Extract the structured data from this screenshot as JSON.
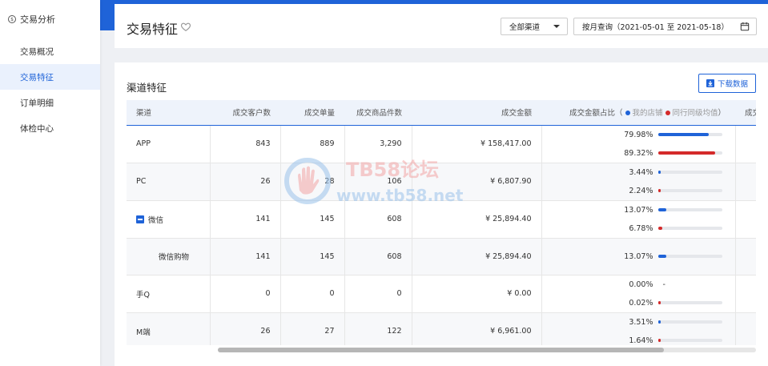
{
  "sidebar": {
    "header": "交易分析",
    "items": [
      {
        "label": "交易概况",
        "active": false
      },
      {
        "label": "交易特征",
        "active": true
      },
      {
        "label": "订单明细",
        "active": false
      },
      {
        "label": "体检中心",
        "active": false
      }
    ]
  },
  "header": {
    "title": "交易特征",
    "channel_select": "全部渠道",
    "date_range": "按月查询（2021-05-01 至 2021-05-18）"
  },
  "main": {
    "section_title": "渠道特征",
    "download_label": "下载数据",
    "columns": [
      "渠道",
      "成交客户数",
      "成交单量",
      "成交商品件数",
      "成交金额"
    ],
    "ratio_header": {
      "prefix": "成交金额占比（",
      "mine": "我的店铺",
      "peer": "同行同级均值",
      "suffix": "）",
      "overflow_col": "成交"
    },
    "rows": [
      {
        "channel": "APP",
        "customers": "843",
        "orders": "889",
        "items": "3,290",
        "amount": "¥ 158,417.00",
        "mine": "79.98%",
        "peer": "89.32%"
      },
      {
        "channel": "PC",
        "customers": "26",
        "orders": "28",
        "items": "106",
        "amount": "¥ 6,807.90",
        "mine": "3.44%",
        "peer": "2.24%"
      },
      {
        "channel": "微信",
        "customers": "141",
        "orders": "145",
        "items": "608",
        "amount": "¥ 25,894.40",
        "mine": "13.07%",
        "peer": "6.78%"
      },
      {
        "channel": "微信购物",
        "customers": "141",
        "orders": "145",
        "items": "608",
        "amount": "¥ 25,894.40",
        "mine": "13.07%",
        "peer": ""
      },
      {
        "channel": "手Q",
        "customers": "0",
        "orders": "0",
        "items": "0",
        "amount": "¥ 0.00",
        "mine": "0.00%",
        "mine_dash": "-",
        "peer": "0.02%"
      },
      {
        "channel": "M端",
        "customers": "26",
        "orders": "27",
        "items": "122",
        "amount": "¥ 6,961.00",
        "mine": "3.51%",
        "peer": "1.64%"
      }
    ]
  },
  "watermark": {
    "line1": "TB58论坛",
    "line2": "www.tb58.net"
  },
  "colors": {
    "accent": "#1f63d8",
    "peer": "#d42a2a"
  }
}
